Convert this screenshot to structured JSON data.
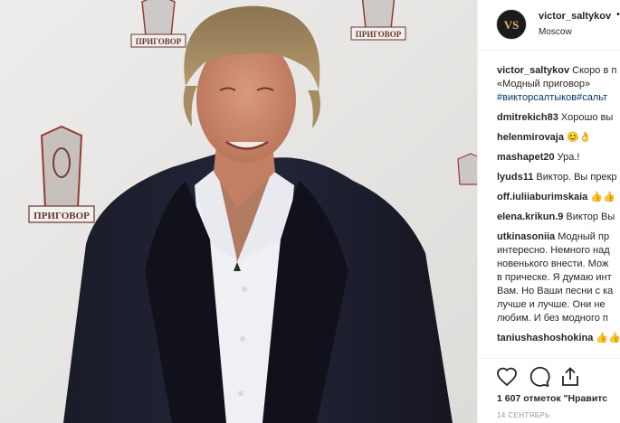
{
  "post": {
    "username": "victor_saltykov",
    "more": "•",
    "location": "Moscow",
    "avatar_text": "VS"
  },
  "photo": {
    "logo_text": "ПРИГОВОР"
  },
  "comments": [
    {
      "user": "victor_saltykov",
      "text": " Скоро в п",
      "cont": [
        "«Модный приговор»",
        "#викторсалтыков#сальт"
      ]
    },
    {
      "user": "dmitrekich83",
      "text": " Хорошо вы"
    },
    {
      "user": "helenmirovaja",
      "text": " 😊👌"
    },
    {
      "user": "mashapet20",
      "text": " Ура.!"
    },
    {
      "user": "lyuds11",
      "text": " Виктор. Вы прекр"
    },
    {
      "user": "off.iuliiaburimskaia",
      "text": " 👍👍"
    },
    {
      "user": "elena.krikun.9",
      "text": " Виктор Вы"
    },
    {
      "user": "utkinasoniia",
      "text": " Модный пр",
      "cont": [
        "интересно. Немного над",
        "новенького внести. Мож",
        "в прическе. Я думаю инт",
        "Вам. Но Ваши песни с ка",
        "лучше и лучше. Они не",
        "любим. И без модного п"
      ]
    },
    {
      "user": "taniushashoshokina",
      "text": " 👍👍"
    }
  ],
  "actions": {
    "likes": "1 607 отметок \"Нравитс",
    "date": "14 СЕНТЯБРЬ"
  }
}
